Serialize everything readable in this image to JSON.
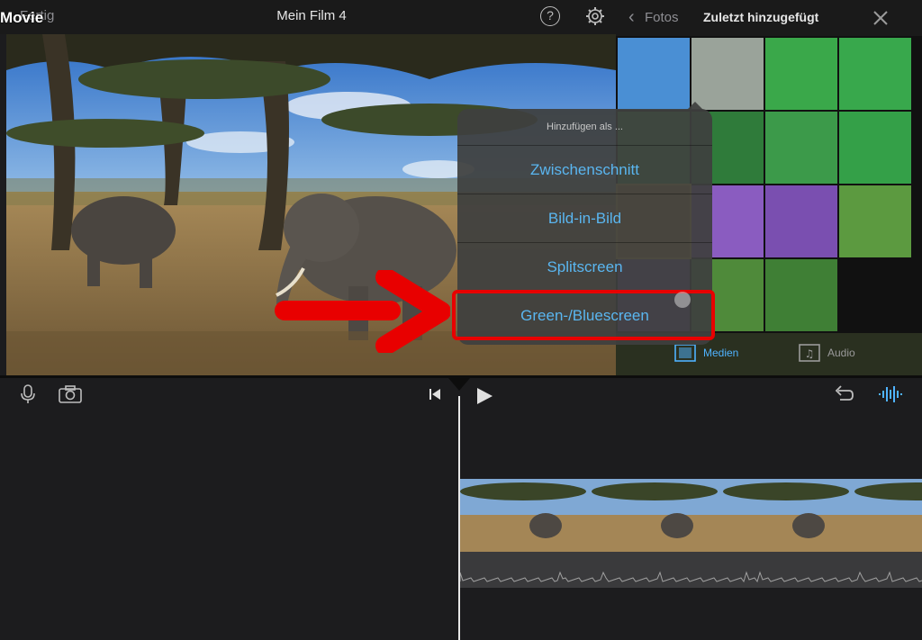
{
  "app": {
    "overlay_label": "Movie",
    "done_label": "Fertig",
    "project_title": "Mein Film 4"
  },
  "toolbar": {
    "help_glyph": "?",
    "help_icon": "help-icon",
    "settings_icon": "gear-icon"
  },
  "media_browser": {
    "back_label": "Fotos",
    "title": "Zuletzt hinzugefügt",
    "close_icon": "close-icon",
    "tabs": [
      {
        "label": "Medien",
        "icon": "film-icon",
        "active": true
      },
      {
        "label": "Audio",
        "icon": "music-note-icon",
        "active": false
      }
    ],
    "thumbnail_colors": [
      "#4a8fd4",
      "#9aa39a",
      "#3aa84a",
      "#38a84c",
      "#41a94f",
      "#2f7b3a",
      "#3c9a4a",
      "#34a048",
      "#c98a3e",
      "#8a5cc0",
      "#7a4fb0",
      "#5c9a40",
      "#7a5ab8",
      "#4f8a3a",
      "#3f7f35"
    ]
  },
  "popover": {
    "header": "Hinzufügen als ...",
    "items": [
      "Zwischenschnitt",
      "Bild-in-Bild",
      "Splitscreen",
      "Green-/Bluescreen"
    ],
    "highlighted_index": 3,
    "item_color": "#5ab6f0"
  },
  "annotation": {
    "color": "#e80000"
  },
  "timeline": {
    "mic_icon": "microphone-icon",
    "camera_icon": "camera-icon",
    "skip_icon": "skip-to-start-icon",
    "play_icon": "play-icon",
    "undo_icon": "undo-icon",
    "waveform_icon": "audio-waveform-icon",
    "accent": "#4fb3ff"
  }
}
